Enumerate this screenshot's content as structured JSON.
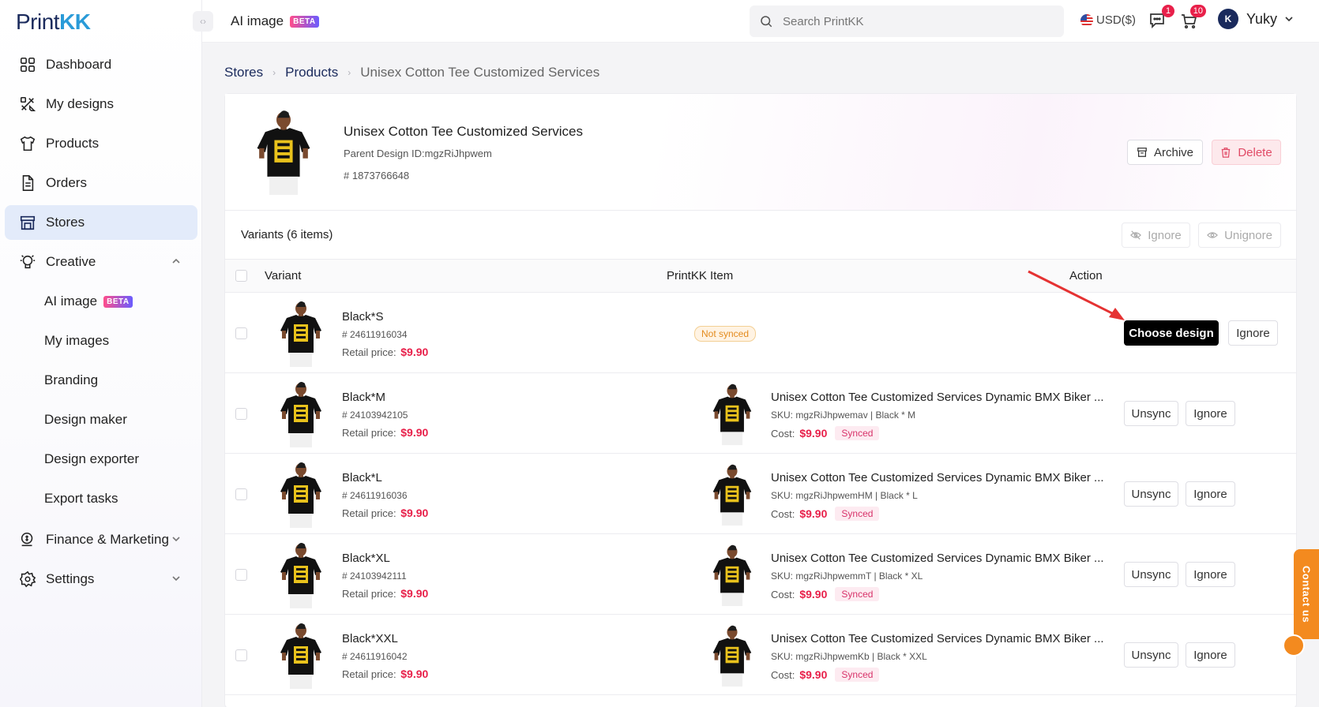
{
  "app": {
    "logo_main": "Print",
    "logo_accent": "KK"
  },
  "sidebar": {
    "items": [
      {
        "label": "Dashboard"
      },
      {
        "label": "My designs"
      },
      {
        "label": "Products"
      },
      {
        "label": "Orders"
      },
      {
        "label": "Stores"
      },
      {
        "label": "Creative"
      },
      {
        "label": "AI image",
        "badge": "BETA"
      },
      {
        "label": "My images"
      },
      {
        "label": "Branding"
      },
      {
        "label": "Design maker"
      },
      {
        "label": "Design exporter"
      },
      {
        "label": "Export tasks"
      },
      {
        "label": "Finance & Marketing"
      },
      {
        "label": "Settings"
      }
    ]
  },
  "topbar": {
    "title": "AI image",
    "badge": "BETA",
    "search_placeholder": "Search PrintKK",
    "currency": "USD($)",
    "messages_count": "1",
    "cart_count": "10",
    "user_initial": "K",
    "user_name": "Yuky"
  },
  "breadcrumb": {
    "stores": "Stores",
    "products": "Products",
    "current": "Unisex Cotton Tee Customized Services"
  },
  "product": {
    "title": "Unisex Cotton Tee Customized Services",
    "parent_design": "Parent Design ID:mgzRiJhpwem",
    "id": "# 1873766648",
    "archive_label": "Archive",
    "delete_label": "Delete"
  },
  "variants": {
    "label": "Variants (6 items)",
    "ignore_label": "Ignore",
    "unignore_label": "Unignore",
    "columns": {
      "variant": "Variant",
      "printkk_item": "PrintKK Item",
      "action": "Action"
    },
    "rows": [
      {
        "name": "Black*S",
        "id": "# 24611916034",
        "price_label": "Retail price:",
        "price": "$9.90",
        "status": "Not synced",
        "primary_action": "Choose design",
        "secondary_action": "Ignore"
      },
      {
        "name": "Black*M",
        "id": "# 24103942105",
        "price_label": "Retail price:",
        "price": "$9.90",
        "pk_title": "Unisex Cotton Tee Customized Services Dynamic BMX Biker ...",
        "pk_sku": "SKU: mgzRiJhpwemav  | Black * M",
        "cost_label": "Cost:",
        "cost": "$9.90",
        "status": "Synced",
        "primary_action": "Unsync",
        "secondary_action": "Ignore"
      },
      {
        "name": "Black*L",
        "id": "# 24611916036",
        "price_label": "Retail price:",
        "price": "$9.90",
        "pk_title": "Unisex Cotton Tee Customized Services Dynamic BMX Biker ...",
        "pk_sku": "SKU: mgzRiJhpwemHM  | Black * L",
        "cost_label": "Cost:",
        "cost": "$9.90",
        "status": "Synced",
        "primary_action": "Unsync",
        "secondary_action": "Ignore"
      },
      {
        "name": "Black*XL",
        "id": "# 24103942111",
        "price_label": "Retail price:",
        "price": "$9.90",
        "pk_title": "Unisex Cotton Tee Customized Services Dynamic BMX Biker ...",
        "pk_sku": "SKU: mgzRiJhpwemmT  | Black * XL",
        "cost_label": "Cost:",
        "cost": "$9.90",
        "status": "Synced",
        "primary_action": "Unsync",
        "secondary_action": "Ignore"
      },
      {
        "name": "Black*XXL",
        "id": "# 24611916042",
        "price_label": "Retail price:",
        "price": "$9.90",
        "pk_title": "Unisex Cotton Tee Customized Services Dynamic BMX Biker ...",
        "pk_sku": "SKU: mgzRiJhpwemKb  | Black * XXL",
        "cost_label": "Cost:",
        "cost": "$9.90",
        "status": "Synced",
        "primary_action": "Unsync",
        "secondary_action": "Ignore"
      }
    ]
  },
  "contact": {
    "label": "Contact us"
  },
  "colors": {
    "accent": "#e8204a",
    "active_nav": "#e3ebfa",
    "brand": "#1a2a5c",
    "contact": "#f38a1f"
  }
}
